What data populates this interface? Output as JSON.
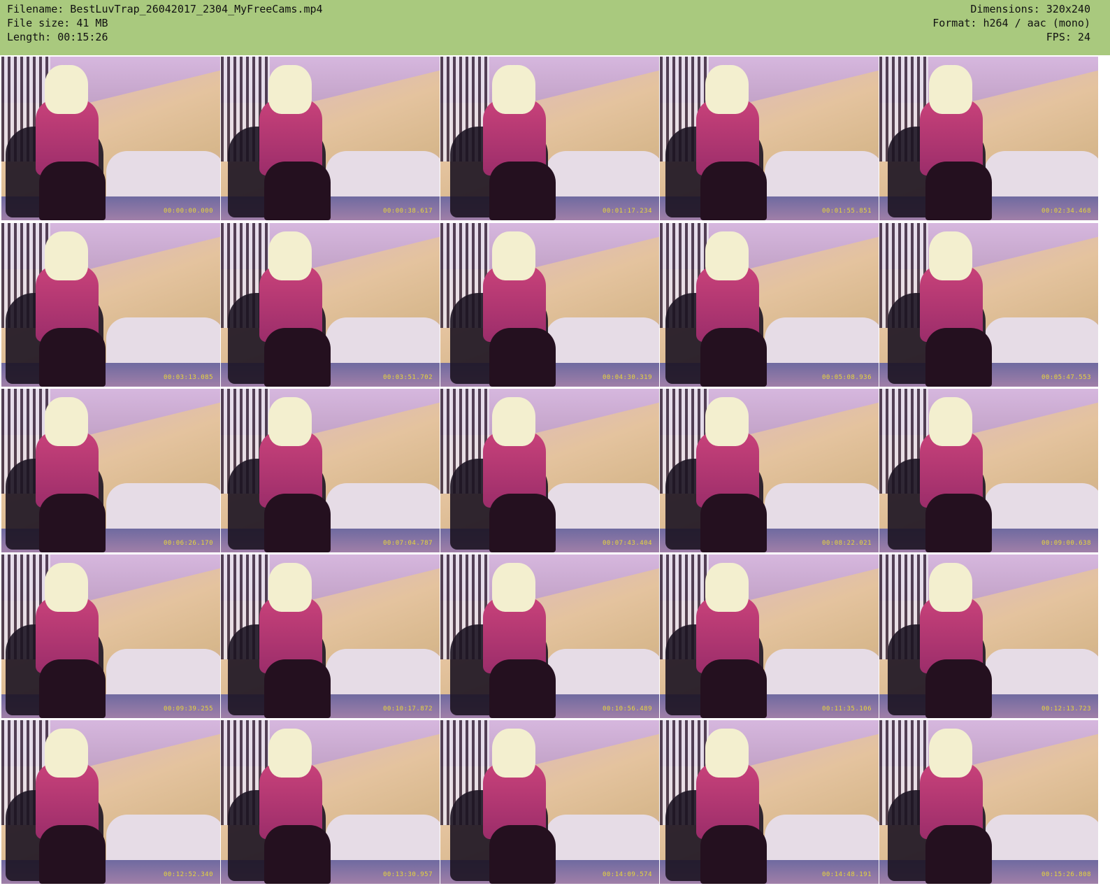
{
  "header": {
    "filename": "Filename: BestLuvTrap_26042017_2304_MyFreeCams.mp4",
    "filesize": "File size: 41 MB",
    "length": "Length: 00:15:26",
    "dimensions": "Dimensions: 320x240",
    "format": "Format: h264 / aac (mono)",
    "fps": "FPS: 24"
  },
  "colors": {
    "header_bg": "#a9c97e",
    "timestamp": "#e8d63a"
  },
  "thumbnails": [
    "00:00:00.000",
    "00:00:38.617",
    "00:01:17.234",
    "00:01:55.851",
    "00:02:34.468",
    "00:03:13.085",
    "00:03:51.702",
    "00:04:30.319",
    "00:05:08.936",
    "00:05:47.553",
    "00:06:26.170",
    "00:07:04.787",
    "00:07:43.404",
    "00:08:22.021",
    "00:09:00.638",
    "00:09:39.255",
    "00:10:17.872",
    "00:10:56.489",
    "00:11:35.106",
    "00:12:13.723",
    "00:12:52.340",
    "00:13:30.957",
    "00:14:09.574",
    "00:14:48.191",
    "00:15:26.808"
  ]
}
